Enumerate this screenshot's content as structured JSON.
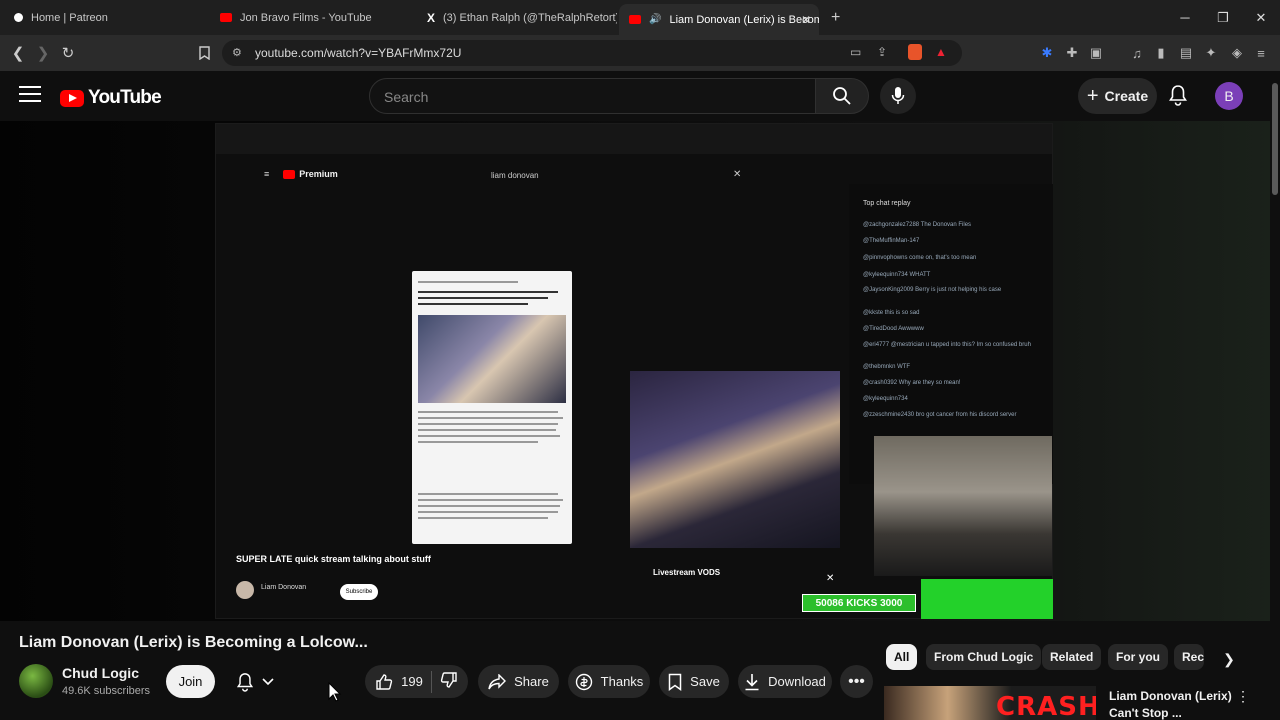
{
  "browser": {
    "tabs": [
      {
        "label": "Home | Patreon",
        "color": "#ffffff"
      },
      {
        "label": "Jon Bravo Films - YouTube",
        "color": "#ff0000"
      },
      {
        "label": "(3) Ethan Ralph (@TheRalphRetort) /",
        "color": "#ffffff"
      },
      {
        "label": "Liam Donovan (Lerix) is Becom",
        "color": "#ff0000"
      }
    ],
    "url": "youtube.com/watch?v=YBAFrMmx72U"
  },
  "header": {
    "logo": "YouTube",
    "search_placeholder": "Search",
    "create_label": "Create",
    "avatar_letter": "B"
  },
  "video": {
    "inner_search": "liam donovan",
    "premium_label": "Premium",
    "chat_header": "Top chat replay",
    "chat_messages": [
      "@zachgonzalez7288 The Donovan Files",
      "@TheMuffinMan-147",
      "@pinnvophowns come on, that's too mean",
      "@kyleequinn734 WHATT",
      "@JaysonKing2009 Berry is just not helping his case",
      "@kkste this is so sad",
      "@TiredDood Awwwww",
      "@eri4777 @mestrician u tapped into this? Im so confused bruh",
      "@thebmnkn WTF",
      "@crash0392 Why are they so mean!",
      "@kyleequinn734",
      "@zzeschmine2430 bro got cancer from his discord server"
    ],
    "stream_title": "SUPER LATE quick stream talking about stuff",
    "stream_channel": "Liam Donovan",
    "stream_subscribe": "Subscribe",
    "livestream_vods": "Livestream VODS",
    "kicks": "50086 KICKS  3000"
  },
  "watch": {
    "title": "Liam Donovan (Lerix) is Becoming a Lolcow...",
    "channel": "Chud Logic",
    "subscribers": "49.6K subscribers",
    "join": "Join",
    "likes": "199",
    "share": "Share",
    "thanks": "Thanks",
    "save": "Save",
    "download": "Download"
  },
  "chips": [
    "All",
    "From Chud Logic",
    "Related",
    "For you",
    "Rec"
  ],
  "recommendation": {
    "thumb_text": "CRASH",
    "title_line1": "Liam Donovan (Lerix)",
    "title_line2": "Can't Stop ..."
  }
}
